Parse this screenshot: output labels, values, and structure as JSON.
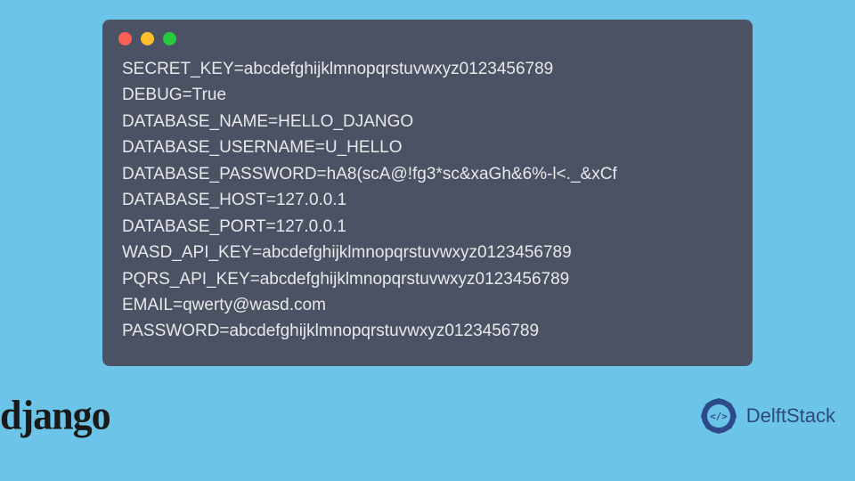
{
  "terminal": {
    "lines": [
      "SECRET_KEY=abcdefghijklmnopqrstuvwxyz0123456789",
      "DEBUG=True",
      "DATABASE_NAME=HELLO_DJANGO",
      "DATABASE_USERNAME=U_HELLO",
      "DATABASE_PASSWORD=hA8(scA@!fg3*sc&xaGh&6%-l<._&xCf",
      "DATABASE_HOST=127.0.0.1",
      "DATABASE_PORT=127.0.0.1",
      "WASD_API_KEY=abcdefghijklmnopqrstuvwxyz0123456789",
      "PQRS_API_KEY=abcdefghijklmnopqrstuvwxyz0123456789",
      "EMAIL=qwerty@wasd.com",
      "PASSWORD=abcdefghijklmnopqrstuvwxyz0123456789"
    ]
  },
  "logos": {
    "django": "django",
    "delftstack": "DelftStack"
  }
}
